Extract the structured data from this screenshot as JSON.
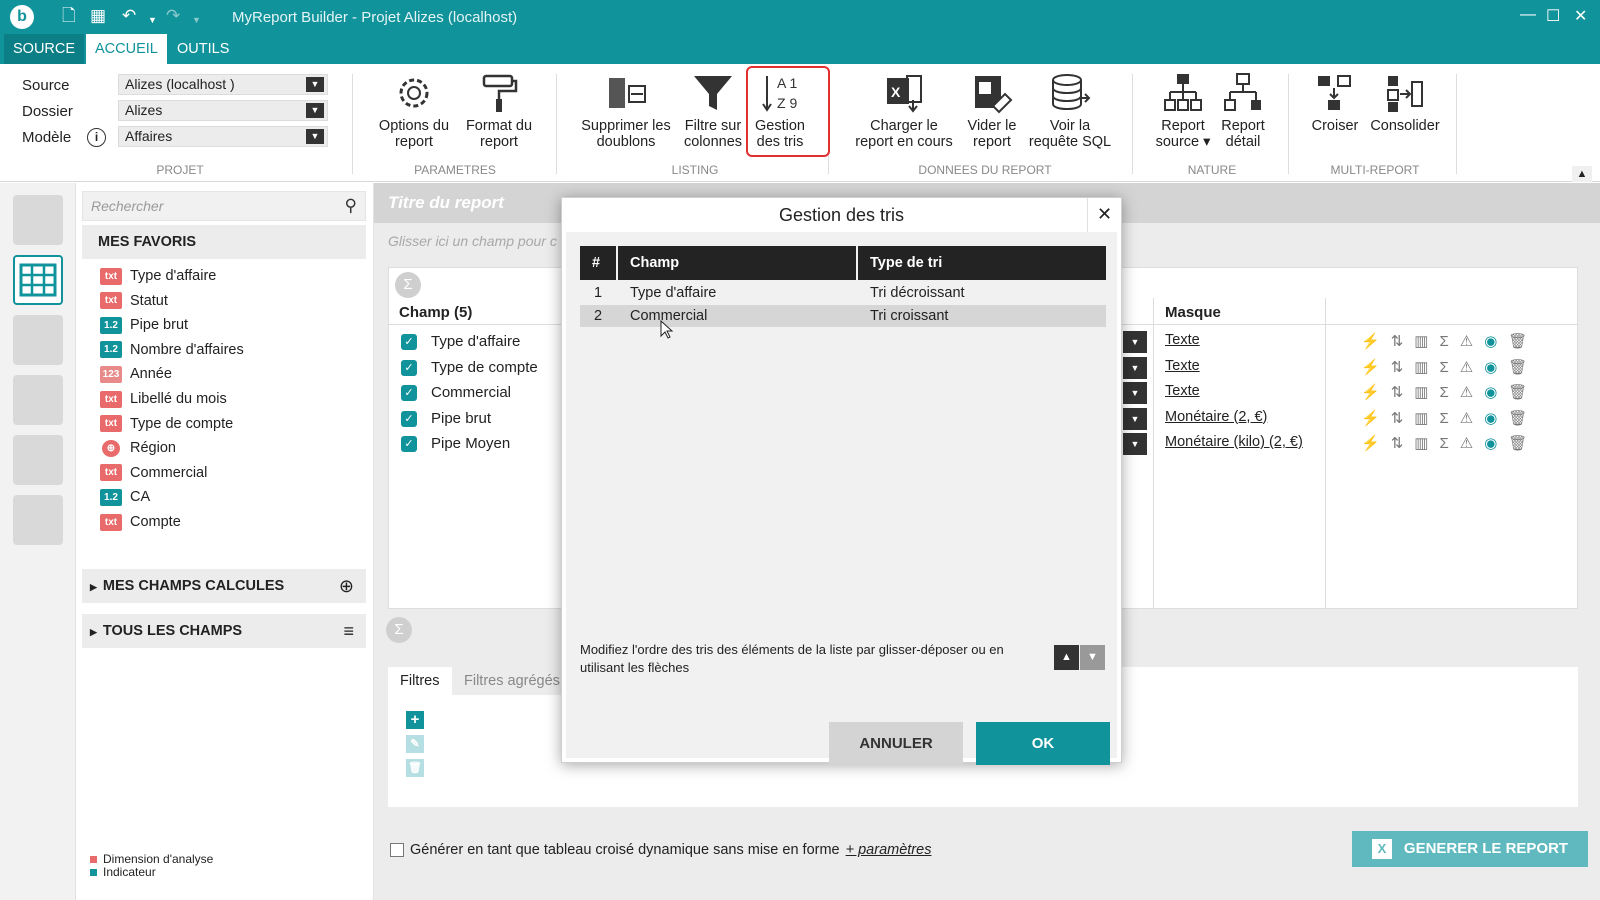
{
  "app": {
    "title": "MyReport Builder - Projet Alizes (localhost)",
    "logo": "b"
  },
  "tabs": [
    {
      "label": "SOURCE"
    },
    {
      "label": "ACCUEIL"
    },
    {
      "label": "OUTILS"
    }
  ],
  "projet": {
    "source_label": "Source",
    "source_value": "Alizes (localhost )",
    "dossier_label": "Dossier",
    "dossier_value": "Alizes",
    "modele_label": "Modèle",
    "modele_value": "Affaires",
    "group": "PROJET"
  },
  "ribbon": {
    "options_l1": "Options du",
    "options_l2": "report",
    "format_l1": "Format du",
    "format_l2": "report",
    "param_group": "PARAMETRES",
    "suppr_l1": "Supprimer les",
    "suppr_l2": "doublons",
    "filtre_l1": "Filtre sur",
    "filtre_l2": "colonnes",
    "tris_l1": "Gestion",
    "tris_l2": "des tris",
    "listing_group": "LISTING",
    "charger_l1": "Charger le",
    "charger_l2": "report en cours",
    "vider_l1": "Vider le",
    "vider_l2": "report",
    "sql_l1": "Voir la",
    "sql_l2": "requête SQL",
    "donnees_group": "DONNEES DU REPORT",
    "rsource_l1": "Report",
    "rsource_l2": "source ▾",
    "rdetail_l1": "Report",
    "rdetail_l2": "détail",
    "nature_group": "NATURE",
    "croiser": "Croiser",
    "consolider": "Consolider",
    "multi_group": "MULTI-REPORT"
  },
  "fields_panel": {
    "search_placeholder": "Rechercher",
    "favoris_title": "MES FAVORIS",
    "favoris": [
      {
        "type": "txt",
        "label": "Type d'affaire"
      },
      {
        "type": "txt",
        "label": "Statut"
      },
      {
        "type": "1.2",
        "label": "Pipe brut"
      },
      {
        "type": "1.2",
        "label": "Nombre d'affaires"
      },
      {
        "type": "123",
        "label": "Année"
      },
      {
        "type": "txt",
        "label": "Libellé du mois"
      },
      {
        "type": "txt",
        "label": "Type de compte"
      },
      {
        "type": "geo",
        "label": "Région"
      },
      {
        "type": "txt",
        "label": "Commercial"
      },
      {
        "type": "1.2",
        "label": "CA"
      },
      {
        "type": "txt",
        "label": "Compte"
      }
    ],
    "calc_title": "MES CHAMPS CALCULES",
    "all_title": "TOUS LES CHAMPS",
    "legend_dim": "Dimension d'analyse",
    "legend_ind": "Indicateur"
  },
  "main": {
    "report_title_placeholder": "Titre du report",
    "drop_hint": "Glisser ici un champ pour c",
    "champ_header": "Champ (5)",
    "masque_header": "Masque",
    "rows": [
      {
        "champ": "Type d'affaire",
        "masque": "Texte"
      },
      {
        "champ": "Type de compte",
        "masque": "Texte"
      },
      {
        "champ": "Commercial",
        "masque": "Texte"
      },
      {
        "champ": "Pipe brut",
        "masque": "Monétaire (2, €)"
      },
      {
        "champ": "Pipe Moyen",
        "masque": "Monétaire (kilo) (2, €)"
      }
    ],
    "filters_tab": "Filtres",
    "filters_agg_tab": "Filtres agrégés",
    "gen_checkbox": "Générer en tant que tableau croisé dynamique sans mise en forme",
    "gen_params": "+ paramètres",
    "gen_button": "GENERER LE REPORT"
  },
  "dialog": {
    "title": "Gestion des tris",
    "col_num": "#",
    "col_champ": "Champ",
    "col_type": "Type de tri",
    "rows": [
      {
        "num": "1",
        "champ": "Type d'affaire",
        "type": "Tri décroissant"
      },
      {
        "num": "2",
        "champ": "Commercial",
        "type": "Tri croissant"
      }
    ],
    "hint": "Modifiez l'ordre des tris des éléments de la liste par glisser-déposer ou en utilisant les flèches",
    "cancel": "ANNULER",
    "ok": "OK"
  },
  "colors": {
    "accent": "#11939b",
    "dim": "#e86a6a",
    "ind": "#11939b",
    "highlight": "#e03030"
  }
}
